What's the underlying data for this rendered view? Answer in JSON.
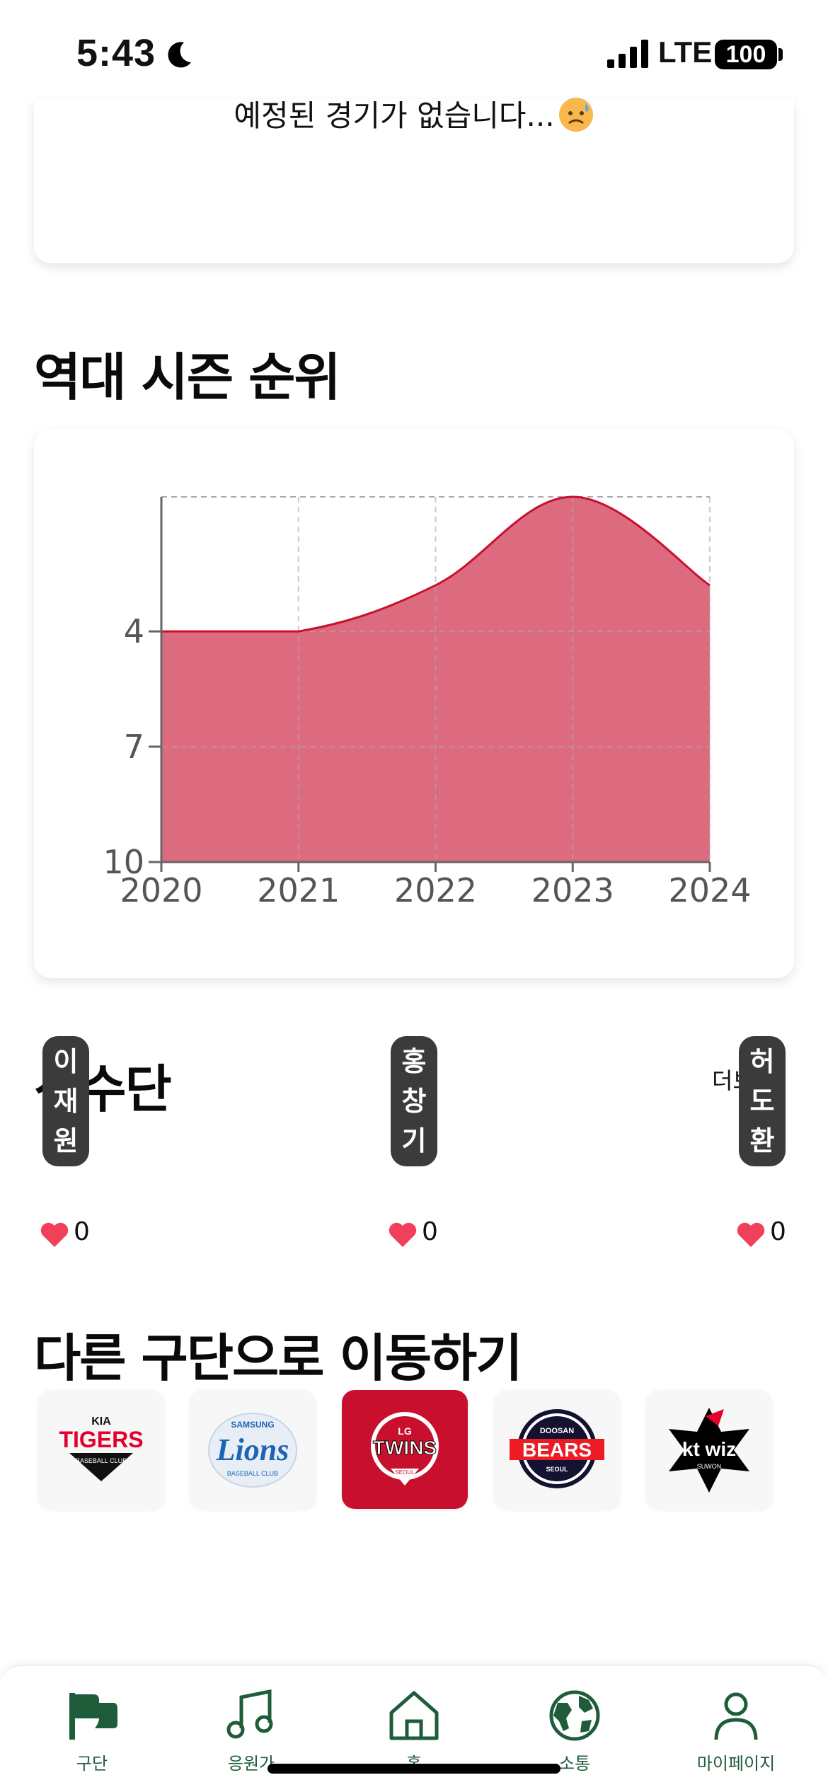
{
  "status_bar": {
    "time": "5:43",
    "network": "LTE",
    "battery": "100"
  },
  "schedule": {
    "empty_message": "예정된 경기가 없습니다..."
  },
  "season_rank": {
    "title": "역대 시즌 순위",
    "chart_data": {
      "type": "area",
      "x": [
        "2020",
        "2021",
        "2022",
        "2023",
        "2024"
      ],
      "series": [
        {
          "values": [
            4,
            4,
            2.8,
            0.5,
            2.8
          ]
        }
      ],
      "y_ticks": [
        "4",
        "7",
        "10"
      ],
      "ylim": [
        10,
        0.5
      ],
      "y_inverted": true,
      "grid": true,
      "fill_color": "#dc6b80",
      "line_color": "#c8102e"
    }
  },
  "players": {
    "title": "선수단",
    "more": "더보기",
    "list": [
      {
        "name": "이재원",
        "chars": [
          "이",
          "재",
          "원"
        ],
        "likes": "0"
      },
      {
        "name": "홍창기",
        "chars": [
          "홍",
          "창",
          "기"
        ],
        "likes": "0"
      },
      {
        "name": "허도환",
        "chars": [
          "허",
          "도",
          "환"
        ],
        "likes": "0"
      }
    ]
  },
  "teams": {
    "title": "다른 구단으로 이동하기",
    "list": [
      {
        "name": "TIGERS",
        "sub": "BASEBALL CLUB",
        "brand": "KIA",
        "color": "#e4002b"
      },
      {
        "name": "Lions",
        "sub": "BASEBALL CLUB",
        "brand": "SAMSUNG",
        "color": "#1d64b4"
      },
      {
        "name": "TWINS",
        "sub": "SEOUL",
        "brand": "LG",
        "color": "#c8102e",
        "active": true
      },
      {
        "name": "BEARS",
        "sub": "SEOUL",
        "brand": "DOOSAN",
        "color": "#131230"
      },
      {
        "name": "kt wiz",
        "sub": "SUWON",
        "brand": "",
        "color": "#000000"
      }
    ]
  },
  "tabs": [
    {
      "label": "구단",
      "icon": "flag-icon"
    },
    {
      "label": "응원가",
      "icon": "music-icon"
    },
    {
      "label": "홈",
      "icon": "home-icon"
    },
    {
      "label": "소통",
      "icon": "globe-icon"
    },
    {
      "label": "마이페이지",
      "icon": "user-icon"
    }
  ],
  "accent_color": "#1f5c3a"
}
